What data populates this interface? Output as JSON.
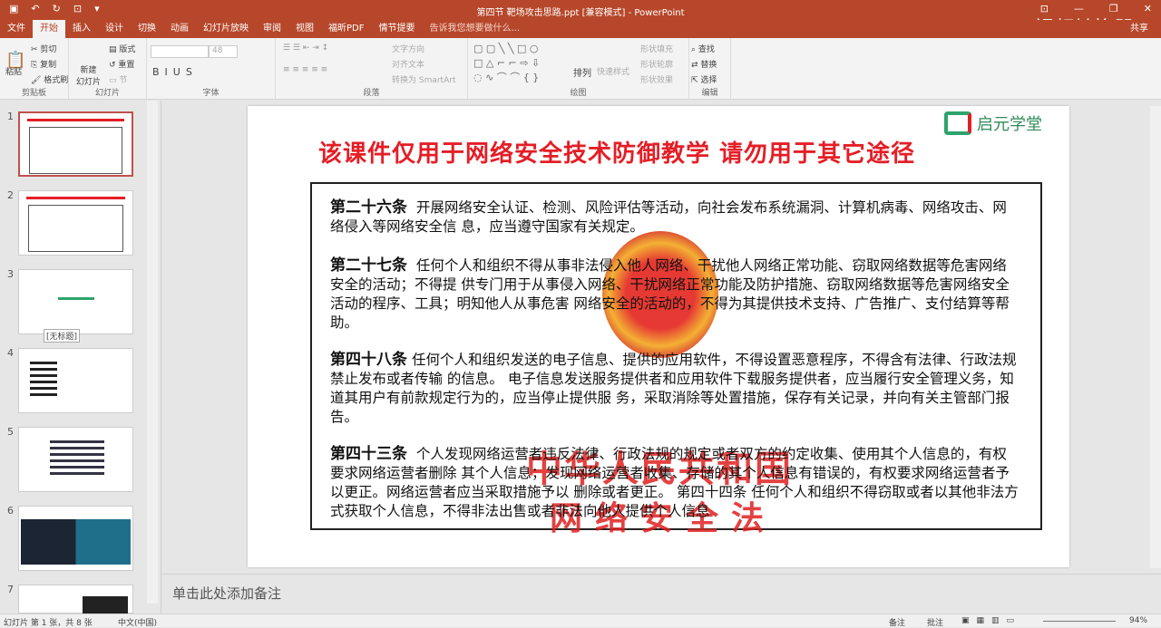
{
  "window": {
    "title": "第四节 靶场攻击思路.ppt [兼容模式] - PowerPoint",
    "share": "共享",
    "watermark": "EV视频转换器"
  },
  "tabs": [
    "文件",
    "开始",
    "插入",
    "设计",
    "切换",
    "动画",
    "幻灯片放映",
    "审阅",
    "视图",
    "福昕PDF",
    "情节提要"
  ],
  "tell_me": "告诉我您想要做什么...",
  "ribbon": {
    "clipboard": {
      "label": "剪贴板",
      "paste": "粘贴",
      "cut": "剪切",
      "copy": "复制",
      "format_painter": "格式刷"
    },
    "slides": {
      "label": "幻灯片",
      "new_slide": "新建\n幻灯片",
      "layout": "版式",
      "reset": "重置",
      "section": "节"
    },
    "font": {
      "label": "字体",
      "size": "48"
    },
    "paragraph": {
      "label": "段落",
      "text_direction": "文字方向",
      "align_text": "对齐文本",
      "smartart": "转换为 SmartArt"
    },
    "drawing": {
      "label": "绘图",
      "arrange": "排列",
      "quick_styles": "快速样式",
      "shape_fill": "形状填充",
      "shape_outline": "形状轮廓",
      "shape_effects": "形状效果"
    },
    "editing": {
      "label": "编辑",
      "find": "查找",
      "replace": "替换",
      "select": "选择"
    }
  },
  "thumbnails": [
    {
      "n": "1"
    },
    {
      "n": "2"
    },
    {
      "n": "3",
      "caption": "[无标题]"
    },
    {
      "n": "4"
    },
    {
      "n": "5"
    },
    {
      "n": "6"
    },
    {
      "n": "7"
    }
  ],
  "slide": {
    "heading": "该课件仅用于网络安全技术防御教学   请勿用于其它途径",
    "logo": "启元学堂",
    "stamp_line1": "中华人民共和国",
    "stamp_line2": "网络安全法",
    "articles": [
      {
        "title": "第二十六条",
        "body": "开展网络安全认证、检测、风险评估等活动，向社会发布系统漏洞、计算机病毒、网络攻击、网络侵入等网络安全信 息，应当遵守国家有关规定。"
      },
      {
        "title": "第二十七条",
        "body": "任何个人和组织不得从事非法侵入他人网络、干扰他人网络正常功能、窃取网络数据等危害网络安全的活动；不得提 供专门用于从事侵入网络、干扰网络正常功能及防护措施、窃取网络数据等危害网络安全活动的程序、工具；明知他人从事危害 网络安全的活动的，不得为其提供技术支持、广告推广、支付结算等帮助。"
      },
      {
        "title": "第四十八条",
        "body": "任何个人和组织发送的电子信息、提供的应用软件，不得设置恶意程序，不得含有法律、行政法规禁止发布或者传输 的信息。 电子信息发送服务提供者和应用软件下载服务提供者，应当履行安全管理义务，知道其用户有前款规定行为的，应当停止提供服 务，采取消除等处置措施，保存有关记录，并向有关主管部门报告。"
      },
      {
        "title": "第四十三条",
        "body": "个人发现网络运营者违反法律、行政法规的规定或者双方的约定收集、使用其个人信息的，有权要求网络运营者删除 其个人信息；发现网络运营者收集、存储的其个人信息有错误的，有权要求网络运营者予以更正。网络运营者应当采取措施予以 删除或者更正。 第四十四条  任何个人和组织不得窃取或者以其他非法方式获取个人信息，不得非法出售或者非法向他人提供个人信息"
      }
    ]
  },
  "notes_placeholder": "单击此处添加备注",
  "status": {
    "slide": "幻灯片 第 1 张，共 8 张",
    "language": "中文(中国)",
    "notes": "备注",
    "comments": "批注",
    "zoom": "94%"
  }
}
